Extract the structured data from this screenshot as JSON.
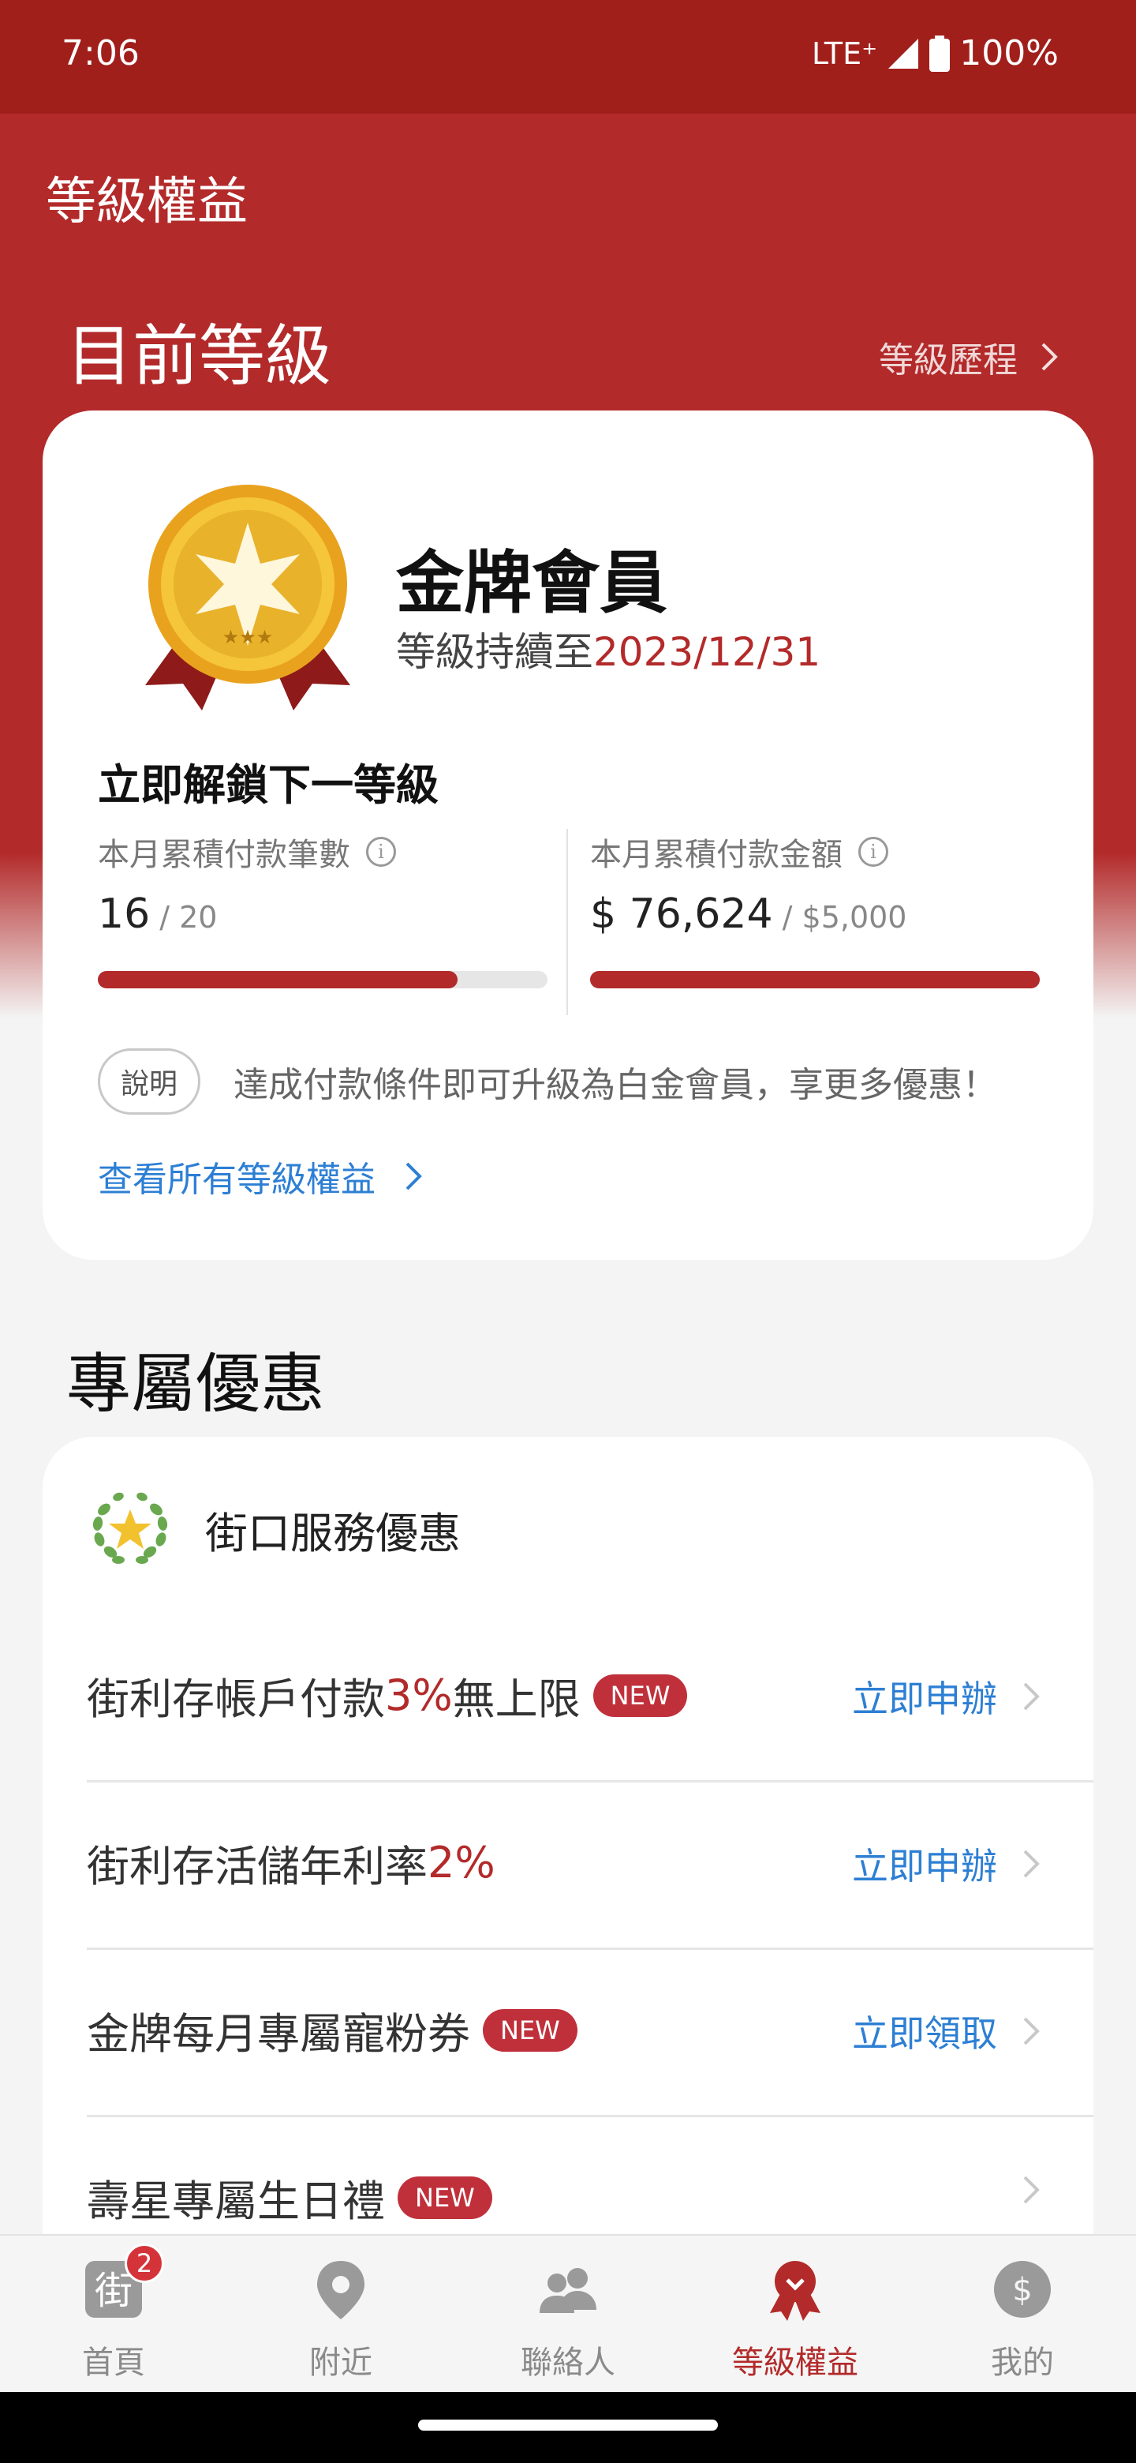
{
  "status_bar": {
    "time": "7:06",
    "network": "LTE⁺",
    "battery": "100%"
  },
  "header": {
    "title": "等級權益"
  },
  "level_section": {
    "title": "目前等級",
    "history_link": "等級歷程",
    "tier_name": "金牌會員",
    "valid_prefix": "等級持續至",
    "valid_date": "2023/12/31",
    "unlock_title": "立即解鎖下一等級",
    "metrics": [
      {
        "label": "本月累積付款筆數",
        "value": "16",
        "target": " / 20",
        "progress": 0.8
      },
      {
        "label": "本月累積付款金額",
        "value": "$ 76,624",
        "target": " / $5,000",
        "progress": 1.0
      }
    ],
    "note_badge": "說明",
    "note_text": "達成付款條件即可升級為白金會員，享更多優惠！",
    "view_all": "查看所有等級權益"
  },
  "offers_section": {
    "title": "專屬優惠",
    "header_label": "街口服務優惠",
    "items": [
      {
        "pre": "街利存帳戶付款",
        "highlight": "3%",
        "post": "無上限",
        "badge": "NEW",
        "action": "立即申辦"
      },
      {
        "pre": "街利存活儲年利率",
        "highlight": "2%",
        "post": "",
        "badge": "",
        "action": "立即申辦"
      },
      {
        "pre": "金牌每月專屬寵粉券",
        "highlight": "",
        "post": "",
        "badge": "NEW",
        "action": "立即領取"
      },
      {
        "pre": "壽星專屬生日禮",
        "highlight": "",
        "post": "",
        "badge": "NEW",
        "action": ""
      }
    ]
  },
  "bottom_nav": {
    "items": [
      {
        "label": "首頁",
        "icon": "home-street-icon",
        "badge": "2",
        "icon_glyph": "街"
      },
      {
        "label": "附近",
        "icon": "location-pin-icon"
      },
      {
        "label": "聯絡人",
        "icon": "contacts-icon"
      },
      {
        "label": "等級權益",
        "icon": "medal-icon",
        "active": true
      },
      {
        "label": "我的",
        "icon": "dollar-account-icon",
        "icon_glyph": "$"
      }
    ]
  },
  "colors": {
    "brand_red": "#b32a2a",
    "status_red": "#a11f1b",
    "link_blue": "#2d7fd4",
    "badge_red": "#c0303b"
  }
}
